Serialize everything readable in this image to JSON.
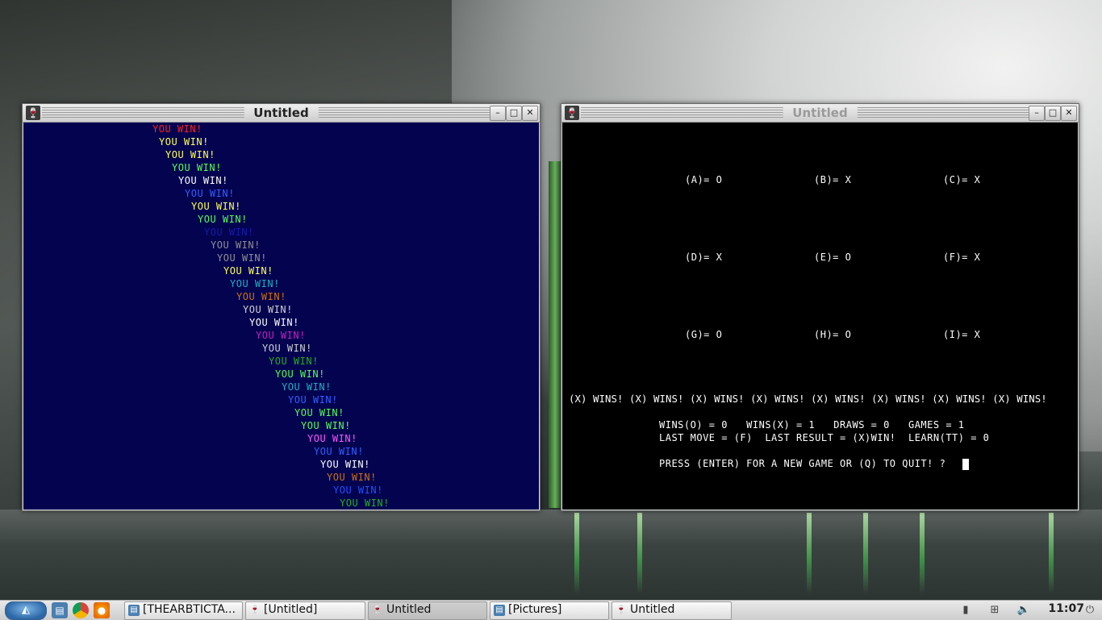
{
  "left_window": {
    "title": "Untitled",
    "lines": [
      {
        "text": "YOU WIN!",
        "color": "#ff2020"
      },
      {
        "text": "YOU WIN!",
        "color": "#ffff55"
      },
      {
        "text": "YOU WIN!",
        "color": "#ffff55"
      },
      {
        "text": "YOU WIN!",
        "color": "#55ff55"
      },
      {
        "text": "YOU WIN!",
        "color": "#ffffff"
      },
      {
        "text": "YOU WIN!",
        "color": "#3060ff"
      },
      {
        "text": "YOU WIN!",
        "color": "#ffff55"
      },
      {
        "text": "YOU WIN!",
        "color": "#55ff55"
      },
      {
        "text": "YOU WIN!",
        "color": "#1818b0"
      },
      {
        "text": "YOU WIN!",
        "color": "#909090"
      },
      {
        "text": "YOU WIN!",
        "color": "#909090"
      },
      {
        "text": "YOU WIN!",
        "color": "#ffff55"
      },
      {
        "text": "YOU WIN!",
        "color": "#20b0c0"
      },
      {
        "text": "YOU WIN!",
        "color": "#d07010"
      },
      {
        "text": "YOU WIN!",
        "color": "#d0d0d0"
      },
      {
        "text": "YOU WIN!",
        "color": "#ffffff"
      },
      {
        "text": "YOU WIN!",
        "color": "#c020c0"
      },
      {
        "text": "YOU WIN!",
        "color": "#d0d0d0"
      },
      {
        "text": "YOU WIN!",
        "color": "#20b020"
      },
      {
        "text": "YOU WIN!",
        "color": "#55ff55"
      },
      {
        "text": "YOU WIN!",
        "color": "#20b0c0"
      },
      {
        "text": "YOU WIN!",
        "color": "#3060ff"
      },
      {
        "text": "YOU WIN!",
        "color": "#55ff55"
      },
      {
        "text": "YOU WIN!",
        "color": "#55ff55"
      },
      {
        "text": "YOU WIN!",
        "color": "#ff55ff"
      },
      {
        "text": "YOU WIN!",
        "color": "#3060ff"
      },
      {
        "text": "YOU WIN!",
        "color": "#ffffff"
      },
      {
        "text": "YOU WIN!",
        "color": "#d07010"
      },
      {
        "text": "YOU WIN!",
        "color": "#2050ff"
      },
      {
        "text": "YOU WIN!",
        "color": "#20b020"
      }
    ]
  },
  "right_window": {
    "title": "Untitled",
    "board": [
      {
        "label": "(A)= O"
      },
      {
        "label": "(B)= X"
      },
      {
        "label": "(C)= X"
      },
      {
        "label": "(D)= X"
      },
      {
        "label": "(E)= O"
      },
      {
        "label": "(F)= X"
      },
      {
        "label": "(G)= O"
      },
      {
        "label": "(H)= O"
      },
      {
        "label": "(I)= X"
      }
    ],
    "wins_banner": "(X) WINS! (X) WINS! (X) WINS! (X) WINS! (X) WINS! (X) WINS! (X) WINS! (X) WINS!",
    "stats_line": "WINS(O) = 0   WINS(X) = 1   DRAWS = 0   GAMES = 1",
    "last_line": "LAST MOVE = (F)  LAST RESULT = (X)WIN!  LEARN(TT) = 0",
    "prompt": "PRESS (ENTER) FOR A NEW GAME OR (Q) TO QUIT! ?"
  },
  "taskbar": {
    "tasks": [
      {
        "label": "[THEARBTICTA...",
        "icon": "folder-icon"
      },
      {
        "label": "[Untitled]",
        "icon": "wine-icon"
      },
      {
        "label": "Untitled",
        "icon": "wine-icon"
      },
      {
        "label": "[Pictures]",
        "icon": "folder-icon"
      },
      {
        "label": "Untitled",
        "icon": "wine-icon"
      }
    ],
    "clock": "11:07"
  }
}
